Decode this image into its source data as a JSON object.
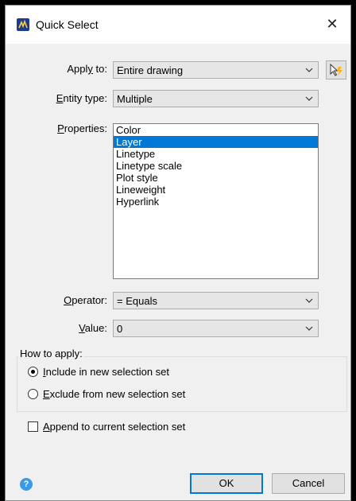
{
  "window": {
    "title": "Quick Select",
    "close_glyph": "✕"
  },
  "apply_to": {
    "label_pre": "Appl",
    "label_u": "y",
    "label_post": " to:",
    "value": "Entire drawing"
  },
  "entity_type": {
    "label_pre": "",
    "label_u": "E",
    "label_post": "ntity type:",
    "value": "Multiple"
  },
  "properties": {
    "label_pre": "",
    "label_u": "P",
    "label_post": "roperties:",
    "items": [
      "Color",
      "Layer",
      "Linetype",
      "Linetype scale",
      "Plot style",
      "Lineweight",
      "Hyperlink"
    ],
    "selected_index": 1
  },
  "operator": {
    "label_pre": "",
    "label_u": "O",
    "label_post": "perator:",
    "value": "= Equals"
  },
  "value": {
    "label_pre": "",
    "label_u": "V",
    "label_post": "alue:",
    "value": "0"
  },
  "how_to_apply": {
    "label": "How to apply:",
    "include": {
      "u": "I",
      "rest": "nclude in new selection set",
      "checked": true
    },
    "exclude": {
      "u": "E",
      "rest": "xclude from new selection set",
      "checked": false
    }
  },
  "append": {
    "u": "A",
    "rest": "ppend to current selection set",
    "checked": false
  },
  "buttons": {
    "ok": "OK",
    "cancel": "Cancel",
    "help": "?"
  },
  "colors": {
    "accent": "#0078d7",
    "titlebar": "#ffffff",
    "dialog_bg": "#f0f0f0",
    "help_icon": "#3b9ae8"
  },
  "icons": {
    "app": "quickselect-app-icon",
    "pick": "select-objects-icon",
    "dropdown": "chevron-down-icon"
  }
}
